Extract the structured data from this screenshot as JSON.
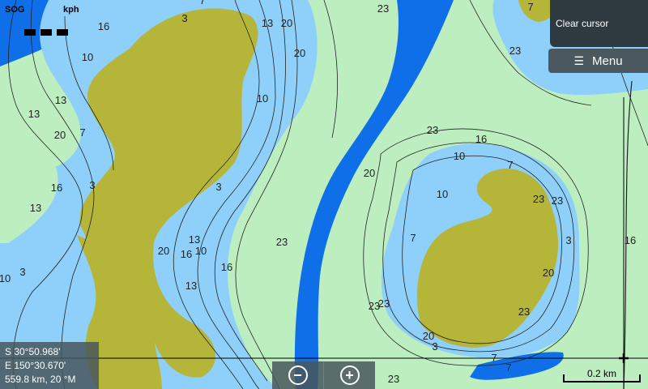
{
  "sog": {
    "label": "SOG",
    "unit": "kph",
    "value": "———"
  },
  "cursor_button": {
    "label": "Clear cursor"
  },
  "menu_button": {
    "label": "Menu",
    "icon": "hamburger-icon"
  },
  "position": {
    "lat": "S  30°50.968'",
    "lon": "E 150°30.670'",
    "range_bearing": "559.8 km, 20 °M"
  },
  "zoom": {
    "out_icon": "zoom-out-icon",
    "in_icon": "zoom-in-icon",
    "out_symbol": "−",
    "in_symbol": "+"
  },
  "scale": {
    "label": "0.2 km"
  },
  "colors": {
    "shallow_land": "#b5b53a",
    "shallow_water": "#8fd0fb",
    "mid_water": "#bdeec0",
    "deep_water": "#0f6fe8",
    "contour": "#222222"
  },
  "depth_labels": [
    "7",
    "3",
    "16",
    "10",
    "13",
    "20",
    "23",
    "20",
    "7",
    "23",
    "13",
    "10",
    "13",
    "20",
    "7",
    "23",
    "16",
    "10",
    "3",
    "7",
    "16",
    "3",
    "20",
    "13",
    "10",
    "23",
    "23",
    "23",
    "7",
    "3",
    "13",
    "20",
    "16",
    "10",
    "16",
    "16",
    "3",
    "10",
    "13",
    "20",
    "23",
    "23",
    "23",
    "20",
    "3",
    "7",
    "7",
    "23"
  ]
}
